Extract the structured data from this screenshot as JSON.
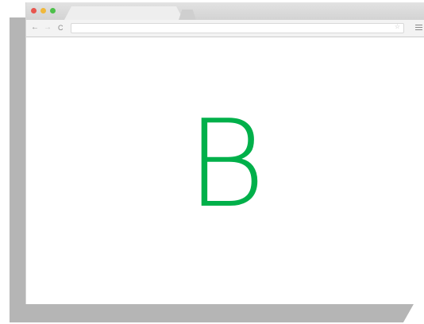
{
  "browser": {
    "traffic_lights": [
      {
        "name": "close",
        "color": "#e8554e"
      },
      {
        "name": "minimize",
        "color": "#f0b83b"
      },
      {
        "name": "maximize",
        "color": "#4cc04a"
      }
    ],
    "tab": {
      "title": ""
    },
    "toolbar": {
      "back_icon": "←",
      "forward_icon": "→",
      "reload_icon": "C",
      "address": "",
      "bookmark_icon": "☆"
    }
  },
  "content": {
    "letter": "B",
    "letter_color": "#00b04a"
  }
}
